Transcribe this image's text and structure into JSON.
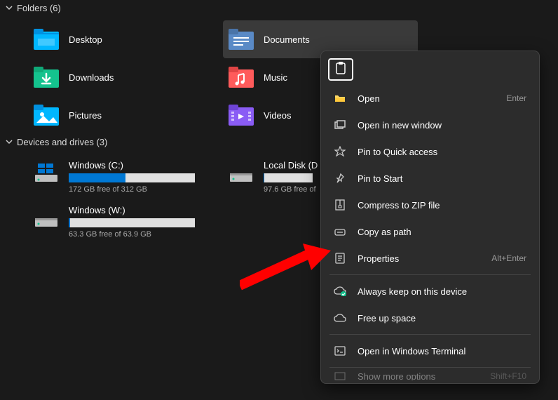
{
  "sections": {
    "folders": {
      "title": "Folders (6)"
    },
    "drives": {
      "title": "Devices and drives (3)"
    }
  },
  "folders": [
    {
      "label": "Desktop",
      "icon": "desktop",
      "selected": false
    },
    {
      "label": "Documents",
      "icon": "documents",
      "selected": true
    },
    {
      "label": "Downloads",
      "icon": "downloads",
      "selected": false
    },
    {
      "label": "Music",
      "icon": "music",
      "selected": false
    },
    {
      "label": "Pictures",
      "icon": "pictures",
      "selected": false
    },
    {
      "label": "Videos",
      "icon": "videos",
      "selected": false
    }
  ],
  "drives": [
    {
      "name": "Windows (C:)",
      "free": "172 GB free of 312 GB",
      "fill": 45,
      "icon": "windows"
    },
    {
      "name": "Local Disk (D",
      "free": "97.6 GB free of",
      "fill": 2,
      "icon": "disk"
    },
    {
      "name": "Windows (W:)",
      "free": "63.3 GB free of 63.9 GB",
      "fill": 1,
      "icon": "disk"
    }
  ],
  "context_menu": {
    "items": [
      {
        "icon": "open",
        "label": "Open",
        "shortcut": "Enter"
      },
      {
        "icon": "newwindow",
        "label": "Open in new window",
        "shortcut": ""
      },
      {
        "icon": "pin",
        "label": "Pin to Quick access",
        "shortcut": ""
      },
      {
        "icon": "pin",
        "label": "Pin to Start",
        "shortcut": ""
      },
      {
        "icon": "zip",
        "label": "Compress to ZIP file",
        "shortcut": ""
      },
      {
        "icon": "copypath",
        "label": "Copy as path",
        "shortcut": ""
      },
      {
        "icon": "properties",
        "label": "Properties",
        "shortcut": "Alt+Enter"
      },
      {
        "sep": true
      },
      {
        "icon": "cloudcheck",
        "label": "Always keep on this device",
        "shortcut": ""
      },
      {
        "icon": "cloud",
        "label": "Free up space",
        "shortcut": ""
      },
      {
        "sep": true
      },
      {
        "icon": "terminal",
        "label": "Open in Windows Terminal",
        "shortcut": ""
      },
      {
        "sep": true
      },
      {
        "icon": "more",
        "label": "Show more options",
        "shortcut": "Shift+F10",
        "cut": true
      }
    ]
  }
}
